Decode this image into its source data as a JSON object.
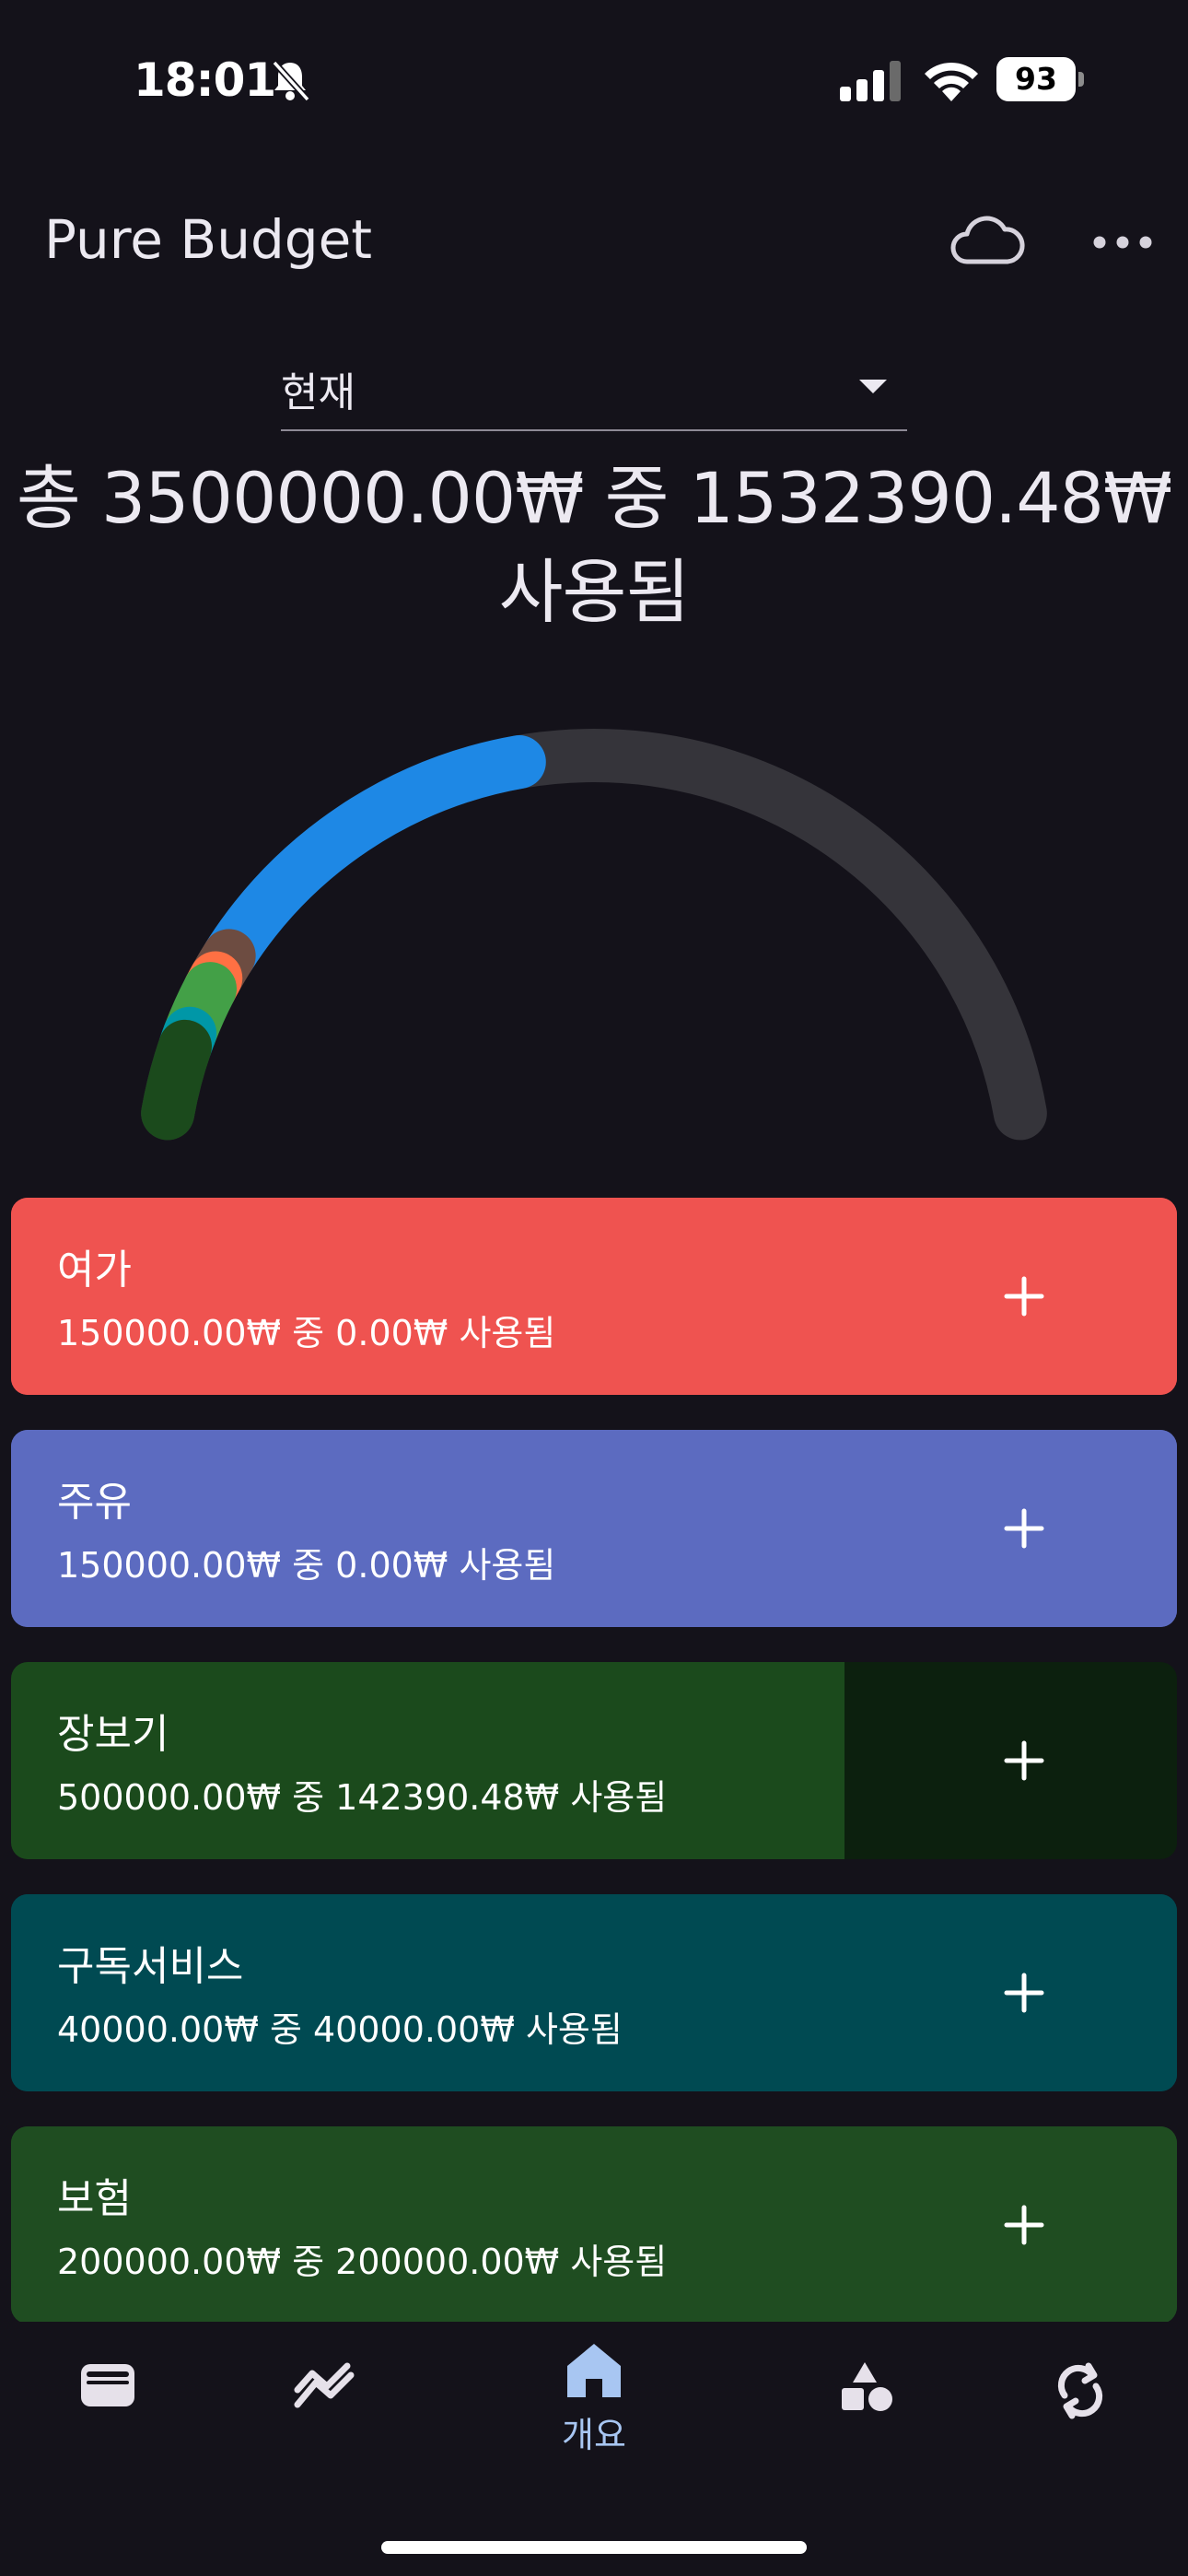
{
  "status": {
    "time": "18:01",
    "battery": "93"
  },
  "app": {
    "title": "Pure Budget"
  },
  "period": {
    "selected": "현재"
  },
  "summary": {
    "line1": "총 3500000.00₩ 중 1532390.48₩",
    "line2": "사용됨"
  },
  "gauge": {
    "total": 3500000,
    "spent": 1532390.48,
    "track_color": "#35343a",
    "segments": [
      {
        "category": "보험",
        "value": 200000,
        "color": "#1b4a1c"
      },
      {
        "category": "구독서비스",
        "value": 40000,
        "color": "#0097a7"
      },
      {
        "category": "장보기",
        "value": 142390.48,
        "color": "#43a047"
      },
      {
        "category": "orange",
        "value": 35000,
        "color": "#ff7043"
      },
      {
        "category": "brown",
        "value": 75000,
        "color": "#6d4c41"
      },
      {
        "category": "blue",
        "value": 1040000,
        "color": "#1e88e5"
      }
    ]
  },
  "budgets": [
    {
      "name": "여가",
      "detail": "150000.00₩ 중 0.00₩ 사용됨",
      "color": "#ef5350",
      "dark": "#ef5350",
      "spent_fraction": 1.0
    },
    {
      "name": "주유",
      "detail": "150000.00₩ 중 0.00₩ 사용됨",
      "color": "#5c6bc0",
      "dark": "#5c6bc0",
      "spent_fraction": 1.0
    },
    {
      "name": "장보기",
      "detail": "500000.00₩ 중 142390.48₩ 사용됨",
      "color": "#1b4a1c",
      "dark": "#0c200e",
      "spent_fraction": 0.715
    },
    {
      "name": "구독서비스",
      "detail": "40000.00₩ 중 40000.00₩ 사용됨",
      "color": "#004a52",
      "dark": "#004a52",
      "spent_fraction": 1.0
    },
    {
      "name": "보험",
      "detail": "200000.00₩ 중 200000.00₩ 사용됨",
      "color": "#1f4d21",
      "dark": "#1f4d21",
      "spent_fraction": 1.0
    }
  ],
  "nav": {
    "home_label": "개요",
    "active_color": "#a8c6f2",
    "icon_color": "#e6e1ea",
    "items": [
      "wallet-icon",
      "trend-icon",
      "home-icon",
      "categories-icon",
      "sync-icon"
    ]
  }
}
